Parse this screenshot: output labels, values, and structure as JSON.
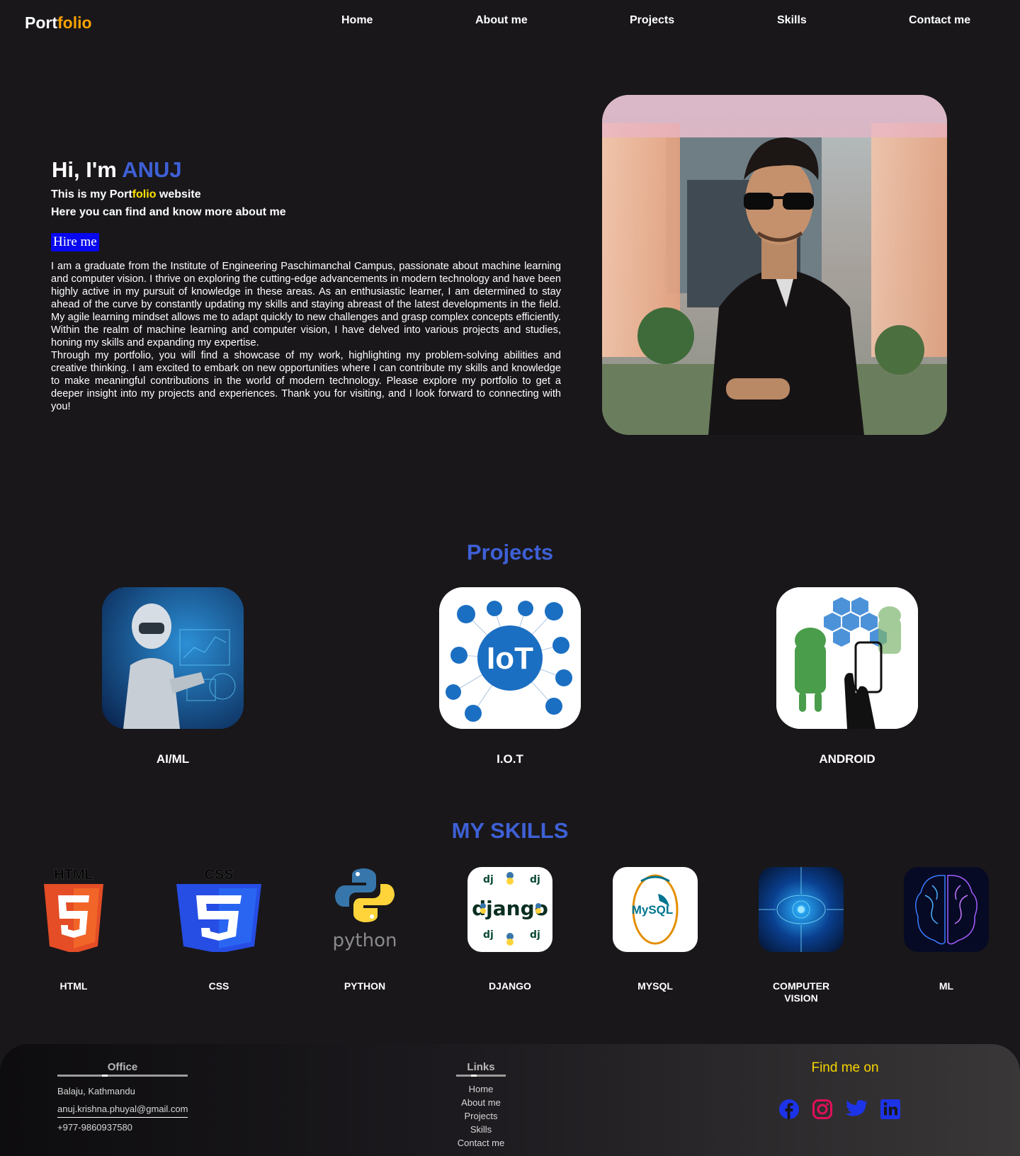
{
  "nav": {
    "logo_main": "Port",
    "logo_accent": "folio",
    "items": [
      "Home",
      "About me",
      "Projects",
      "Skills",
      "Contact me"
    ]
  },
  "hero": {
    "greeting": "Hi, I'm ",
    "name": "ANUJ",
    "line1_a": "This is my Port",
    "line1_b": "folio",
    "line1_c": " website",
    "line2": "Here you can find and know more about me",
    "hire_label": "Hire me",
    "about_p1": "I am a graduate from the Institute of Engineering Paschimanchal Campus, passionate about machine learning and computer vision. I thrive on exploring the cutting-edge advancements in modern technology and have been highly active in my pursuit of knowledge in these areas. As an enthusiastic learner, I am determined to stay ahead of the curve by constantly updating my skills and staying abreast of the latest developments in the field. My agile learning mindset allows me to adapt quickly to new challenges and grasp complex concepts efficiently. Within the realm of machine learning and computer vision, I have delved into various projects and studies, honing my skills and expanding my expertise.",
    "about_p2": "Through my portfolio, you will find a showcase of my work, highlighting my problem-solving abilities and creative thinking. I am excited to embark on new opportunities where I can contribute my skills and knowledge to make meaningful contributions in the world of modern technology. Please explore my portfolio to get a deeper insight into my projects and experiences. Thank you for visiting, and I look forward to connecting with you!"
  },
  "projects": {
    "title": "Projects",
    "items": [
      {
        "label": "AI/ML",
        "icon": "robot-ai-image"
      },
      {
        "label": "I.O.T",
        "icon": "iot-image"
      },
      {
        "label": "ANDROID",
        "icon": "android-image"
      }
    ]
  },
  "skills": {
    "title": "MY SKILLS",
    "items": [
      {
        "label": "HTML",
        "icon": "html5-logo"
      },
      {
        "label": "CSS",
        "icon": "css3-logo"
      },
      {
        "label": "PYTHON",
        "icon": "python-logo"
      },
      {
        "label": "DJANGO",
        "icon": "django-logo"
      },
      {
        "label": "MYSQL",
        "icon": "mysql-logo"
      },
      {
        "label": "COMPUTER VISION",
        "icon": "computer-vision-image"
      },
      {
        "label": "ML",
        "icon": "ml-brain-image"
      }
    ],
    "html_tag": "HTML",
    "css_tag": "CSS",
    "python_word": "python",
    "django_word": "django",
    "mysql_word": "MySQL"
  },
  "footer": {
    "office_title": "Office",
    "address": "Balaju, Kathmandu",
    "email": "anuj.krishna.phuyal@gmail.com",
    "phone": "+977-9860937580",
    "links_title": "Links",
    "links": [
      "Home",
      "About me",
      "Projects",
      "Skills",
      "Contact me"
    ],
    "find_me": "Find me on",
    "socials": [
      "facebook-icon",
      "instagram-icon",
      "twitter-icon",
      "linkedin-icon"
    ]
  },
  "colors": {
    "background": "#19171a",
    "accent_blue": "#3e60d6",
    "accent_orange": "#f5a200",
    "accent_yellow": "#ffe300",
    "hire_blue": "#0707f0"
  }
}
